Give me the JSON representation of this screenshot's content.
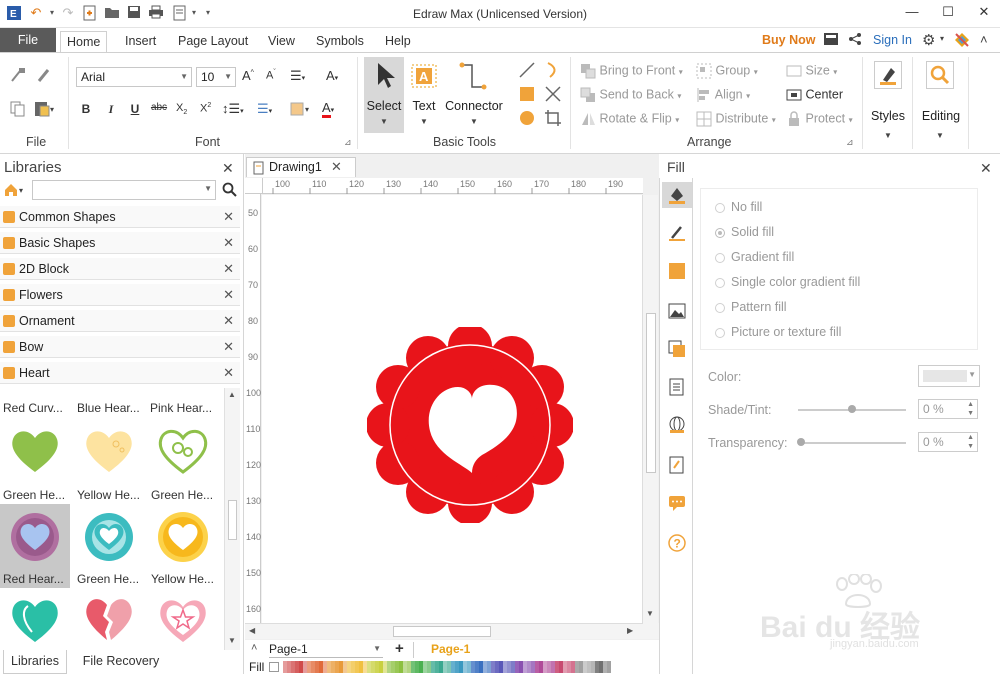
{
  "window": {
    "title": "Edraw Max (Unlicensed Version)"
  },
  "tabs": {
    "file": "File",
    "items": [
      "Home",
      "Insert",
      "Page Layout",
      "View",
      "Symbols",
      "Help"
    ]
  },
  "account": {
    "buy_now": "Buy Now",
    "sign_in": "Sign In"
  },
  "ribbon": {
    "file_group": "File",
    "font_group": "Font",
    "font_name": "Arial",
    "font_size": "10",
    "basic_tools_group": "Basic Tools",
    "select": "Select",
    "text": "Text",
    "connector": "Connector",
    "arrange_group": "Arrange",
    "bring_to_front": "Bring to Front",
    "send_to_back": "Send to Back",
    "rotate_flip": "Rotate & Flip",
    "group": "Group",
    "align": "Align",
    "distribute": "Distribute",
    "size": "Size",
    "center": "Center",
    "protect": "Protect",
    "styles": "Styles",
    "editing": "Editing",
    "bold": "B",
    "italic": "I",
    "underline": "U",
    "strike": "abc"
  },
  "libraries": {
    "title": "Libraries",
    "categories": [
      "Common Shapes",
      "Basic Shapes",
      "2D Block",
      "Flowers",
      "Ornament",
      "Bow",
      "Heart"
    ],
    "thumbs_row0": [
      "Red Curv...",
      "Blue Hear...",
      "Pink Hear..."
    ],
    "thumbs_row1": [
      "Green He...",
      "Yellow He...",
      "Green He..."
    ],
    "thumbs_row2": [
      "Red Hear...",
      "Green He...",
      "Yellow He..."
    ],
    "bottom_tabs": [
      "Libraries",
      "File Recovery"
    ]
  },
  "document": {
    "tab_name": "Drawing1",
    "ruler_h": [
      "100",
      "110",
      "120",
      "130",
      "140",
      "150",
      "160",
      "170",
      "180",
      "190"
    ],
    "ruler_v": [
      "50",
      "60",
      "70",
      "80",
      "90",
      "100",
      "110",
      "120",
      "130",
      "140",
      "150",
      "160"
    ],
    "page_selector": "Page-1",
    "page_tab": "Page-1",
    "fill_label": "Fill"
  },
  "fill_panel": {
    "title": "Fill",
    "options": [
      "No fill",
      "Solid fill",
      "Gradient fill",
      "Single color gradient fill",
      "Pattern fill",
      "Picture or texture fill"
    ],
    "color_label": "Color:",
    "shade_label": "Shade/Tint:",
    "shade_value": "0 %",
    "transparency_label": "Transparency:",
    "transparency_value": "0 %"
  },
  "colors": {
    "accent_orange": "#f0a33a",
    "buy_now": "#e07b1a",
    "sign_in": "#2a6ebb",
    "shape_red": "#e8141a",
    "page_tab": "#e8a21a"
  },
  "watermark": {
    "brand": "Bai du 经验",
    "url": "jingyan.baidu.com"
  }
}
